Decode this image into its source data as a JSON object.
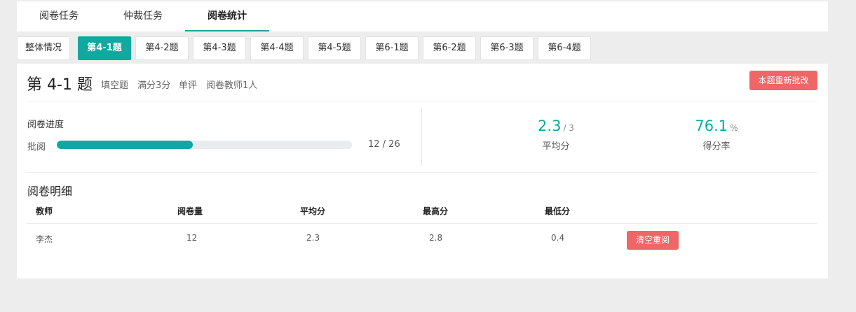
{
  "top_tabs": [
    "阅卷任务",
    "仲裁任务",
    "阅卷统计"
  ],
  "active_top_tab": "阅卷统计",
  "sub_tabs": [
    "整体情况",
    "第4-1题",
    "第4-2题",
    "第4-3题",
    "第4-4题",
    "第4-5题",
    "第6-1题",
    "第6-2题",
    "第6-3题",
    "第6-4题"
  ],
  "active_sub_tab": "第4-1题",
  "question": {
    "title": "第 4-1 题",
    "type": "填空题",
    "full_score": "满分3分",
    "mode": "单评",
    "teachers": "阅卷教师1人",
    "regrade_label": "本题重新批改"
  },
  "progress": {
    "title": "阅卷进度",
    "label": "批阅",
    "count": "12 / 26",
    "fraction": 0.4615
  },
  "stats": {
    "avg_value": "2.3",
    "avg_unit": "/ 3",
    "avg_label": "平均分",
    "rate_value": "76.1",
    "rate_unit": "%",
    "rate_label": "得分率"
  },
  "detail": {
    "title": "阅卷明细",
    "headers": [
      "教师",
      "阅卷量",
      "平均分",
      "最高分",
      "最低分"
    ],
    "rows": [
      {
        "teacher": "李杰",
        "count": "12",
        "avg": "2.3",
        "max": "2.8",
        "min": "0.4",
        "action": "清空重阅"
      }
    ]
  },
  "colors": {
    "accent": "#0fa99f",
    "danger": "#f06666"
  }
}
